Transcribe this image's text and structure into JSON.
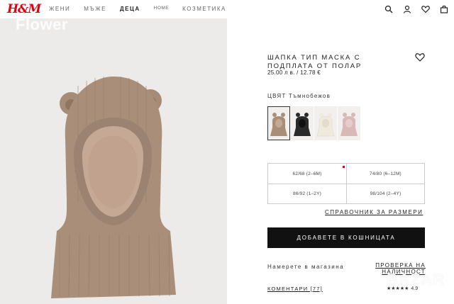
{
  "brand": {
    "logo": "H&M"
  },
  "nav": {
    "items": [
      {
        "label": "ЖЕНИ",
        "active": false
      },
      {
        "label": "МЪЖЕ",
        "active": false
      },
      {
        "label": "ДЕЦА",
        "active": true
      },
      {
        "label": "HOME",
        "active": false
      },
      {
        "label": "КОЗМЕТИКА",
        "active": false
      }
    ]
  },
  "header_icons": [
    "search-icon",
    "account-icon",
    "heart-icon",
    "bag-icon"
  ],
  "image": {
    "watermark": "Flower",
    "alt_colors": {
      "bg": "#ecebe9",
      "hat": "#a98f79"
    }
  },
  "product": {
    "title": "ШАПКА ТИП МАСКА С ПОДПЛАТА ОТ ПОЛАР",
    "price": "25.00 л в. / 12.78 €"
  },
  "color": {
    "label": "ЦВЯТ Тъмнобежов",
    "swatches": [
      {
        "name": "Тъмнобежов",
        "color": "#a98f79",
        "selected": true
      },
      {
        "name": "Черен",
        "color": "#2a2a2a",
        "selected": false
      },
      {
        "name": "Кремав",
        "color": "#efeadc",
        "selected": false
      },
      {
        "name": "Розов",
        "color": "#d9b8b8",
        "selected": false
      }
    ]
  },
  "sizes": [
    {
      "label": "62/68 (2–6M)"
    },
    {
      "label": "74/80 (6–12M)"
    },
    {
      "label": "86/92 (1–2Y)"
    },
    {
      "label": "98/104 (2–4Y)"
    }
  ],
  "size_guide": "СПРАВОЧНИК ЗА РАЗМЕРИ",
  "add_to_cart": "ДОБАВЕТЕ В КОШНИЦАТА",
  "store": {
    "find_label": "Намерете в магазина",
    "check_label": "ПРОВЕРКА НА НАЛИЧНОСТ"
  },
  "reviews": {
    "label": "КОМЕНТАРИ [77]",
    "stars": "★★★★★",
    "score": "4.9"
  },
  "overlay_watermark": "BAZAR",
  "colors": {
    "accent": "#e50010",
    "button": "#111111"
  }
}
